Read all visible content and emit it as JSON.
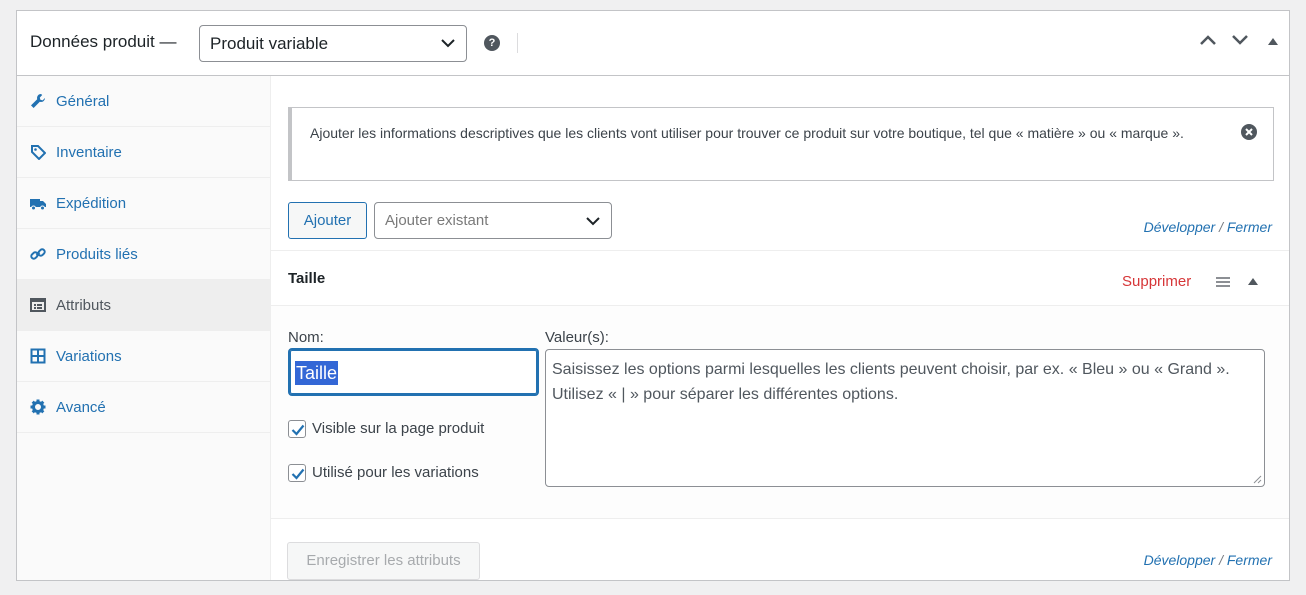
{
  "header": {
    "title": "Données produit —",
    "product_type": "Produit variable"
  },
  "tabs": [
    {
      "label": "Général",
      "icon": "wrench-icon",
      "active": false
    },
    {
      "label": "Inventaire",
      "icon": "tag-icon",
      "active": false
    },
    {
      "label": "Expédition",
      "icon": "truck-icon",
      "active": false
    },
    {
      "label": "Produits liés",
      "icon": "link-icon",
      "active": false
    },
    {
      "label": "Attributs",
      "icon": "list-view-icon",
      "active": true
    },
    {
      "label": "Variations",
      "icon": "grid-icon",
      "active": false
    },
    {
      "label": "Avancé",
      "icon": "gear-icon",
      "active": false
    }
  ],
  "notice": {
    "text": "Ajouter les informations descriptives que les clients vont utiliser pour trouver ce produit sur votre boutique, tel que « matière » ou « marque »."
  },
  "toolbar": {
    "add_label": "Ajouter",
    "existing_placeholder": "Ajouter existant",
    "expand_label": "Développer",
    "slash": "/",
    "close_label": "Fermer"
  },
  "attribute": {
    "name": "Taille",
    "remove_label": "Supprimer",
    "name_label": "Nom:",
    "name_value": "Taille",
    "values_label": "Valeur(s):",
    "values_placeholder": "Saisissez les options parmi lesquelles les clients peuvent choisir, par ex. « Bleu » ou « Grand ». Utilisez « | » pour séparer les différentes options.",
    "visible_label": "Visible sur la page produit",
    "visible_checked": true,
    "variations_label": "Utilisé pour les variations",
    "variations_checked": true
  },
  "footer": {
    "save_label": "Enregistrer les attributs"
  },
  "colors": {
    "link": "#2271b1",
    "danger": "#d63638",
    "selection": "#3367d6"
  }
}
